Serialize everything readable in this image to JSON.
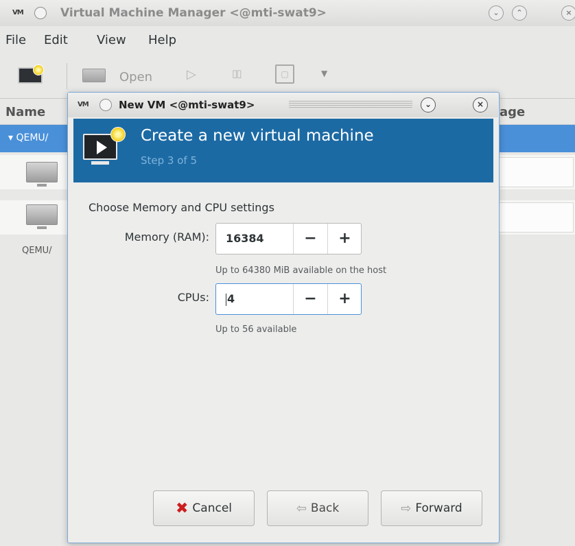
{
  "main_window": {
    "app_glyph": "VM",
    "title": "Virtual Machine Manager <@mti-swat9>",
    "menu": [
      "File",
      "Edit",
      "View",
      "Help"
    ],
    "toolbar": {
      "open_label": "Open"
    },
    "columns": {
      "name": "Name",
      "usage": "age"
    },
    "group_label": "QEMU/",
    "uri_label": "QEMU/"
  },
  "dialog": {
    "title": "New VM <@mti-swat9>",
    "banner_title": "Create a new virtual machine",
    "banner_step": "Step 3 of 5",
    "section_label": "Choose Memory and CPU settings",
    "memory": {
      "label": "Memory (RAM):",
      "value": "16384",
      "hint": "Up to 64380 MiB available on the host"
    },
    "cpus": {
      "label": "CPUs:",
      "value": "4",
      "hint": "Up to 56 available"
    },
    "spin_minus": "−",
    "spin_plus": "+",
    "buttons": {
      "cancel": "Cancel",
      "back": "Back",
      "forward": "Forward"
    }
  },
  "colors": {
    "banner": "#1c6aa4",
    "selection": "#4a90d9",
    "cancel_icon": "#cc1f1f"
  }
}
